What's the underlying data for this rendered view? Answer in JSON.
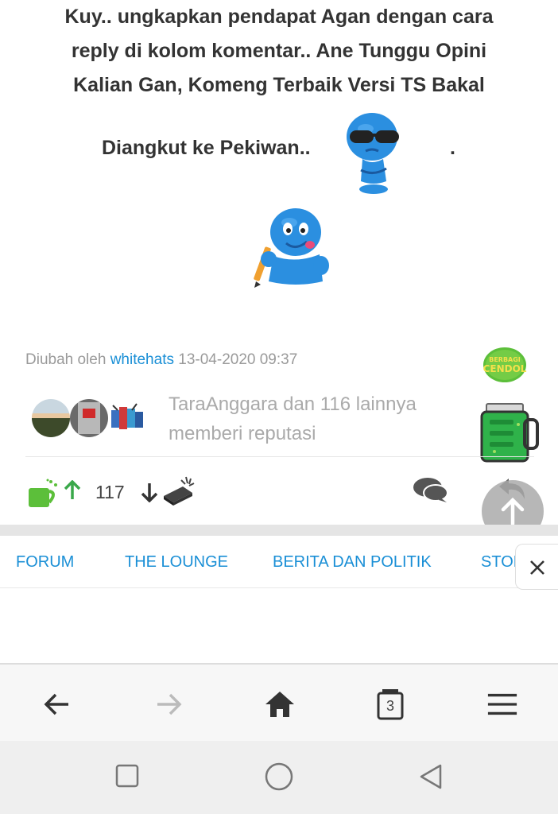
{
  "post": {
    "line1": "Kuy.. ungkapkan pendapat Agan dengan cara",
    "line2": "reply di kolom komentar.. Ane Tunggu Opini",
    "line3": "Kalian Gan, Komeng Terbaik  Versi TS Bakal",
    "line4": "Diangkut ke Pekiwan..",
    "line4_end": "."
  },
  "edited": {
    "prefix": "Diubah oleh",
    "user": "whitehats",
    "timestamp": "13-04-2020 09:37"
  },
  "cendol_badge": {
    "line1": "BERBAGI",
    "line2": "CENDOL"
  },
  "reputation": {
    "text_line1": "TaraAnggara dan 116 lainnya",
    "text_line2": "memberi reputasi"
  },
  "actions": {
    "vote_count": "117"
  },
  "category_nav": {
    "items": [
      "FORUM",
      "THE LOUNGE",
      "BERITA DAN POLITIK",
      "STORY"
    ]
  },
  "browser": {
    "tab_count": "3"
  },
  "colors": {
    "link_blue": "#1a8fd6",
    "cendol_green": "#3bb54a",
    "text_dark": "#333333"
  }
}
